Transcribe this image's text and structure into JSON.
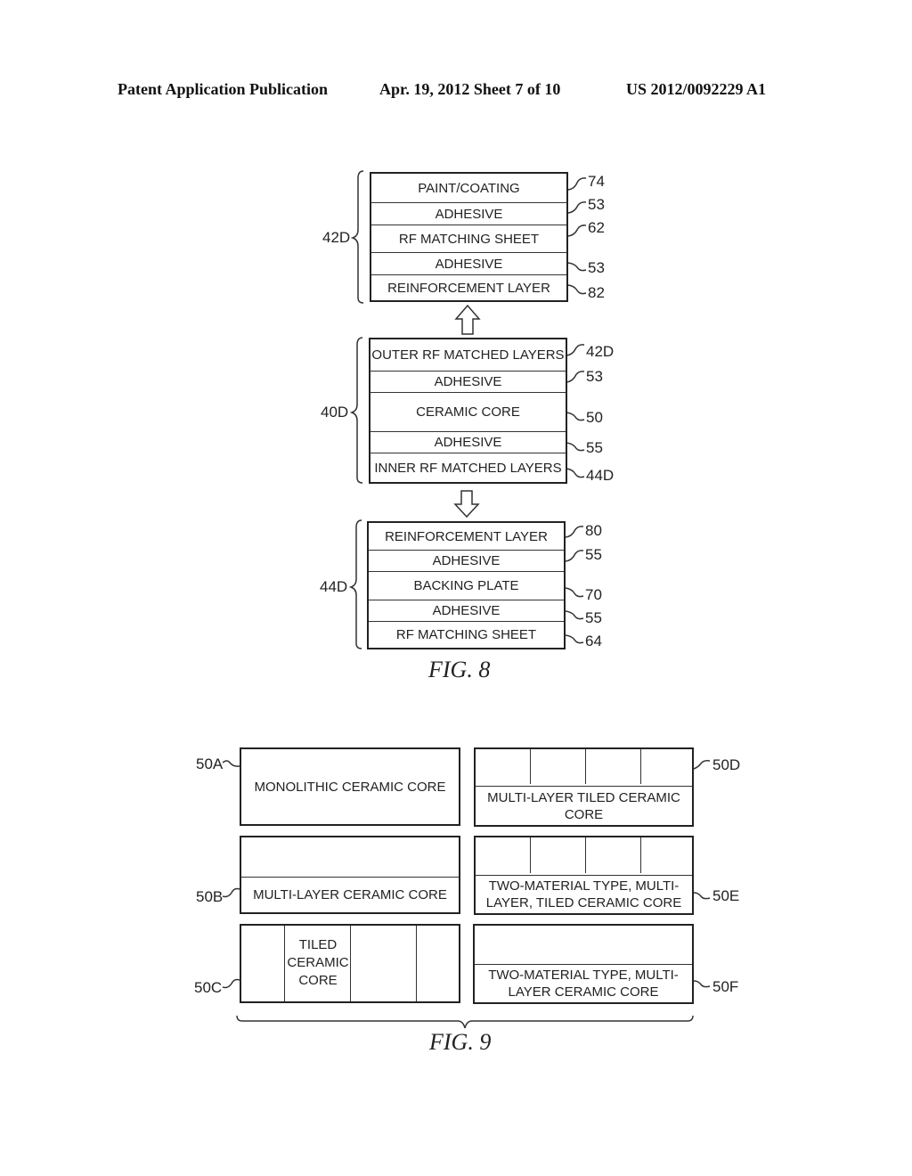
{
  "header": {
    "publication": "Patent Application Publication",
    "date_sheet": "Apr. 19, 2012  Sheet 7 of 10",
    "number": "US 2012/0092229 A1"
  },
  "fig8": {
    "caption": "FIG. 8",
    "stack_42d": {
      "label": "42D",
      "layers": [
        {
          "text": "PAINT/COATING",
          "ref": "74"
        },
        {
          "text": "ADHESIVE",
          "ref": "53"
        },
        {
          "text": "RF MATCHING SHEET",
          "ref": "62"
        },
        {
          "text": "ADHESIVE",
          "ref": "53"
        },
        {
          "text": "REINFORCEMENT LAYER",
          "ref": "82"
        }
      ]
    },
    "stack_40d": {
      "label": "40D",
      "layers": [
        {
          "text": "OUTER RF MATCHED LAYERS",
          "ref": "42D"
        },
        {
          "text": "ADHESIVE",
          "ref": "53"
        },
        {
          "text": "CERAMIC CORE",
          "ref": "50"
        },
        {
          "text": "ADHESIVE",
          "ref": "55"
        },
        {
          "text": "INNER RF MATCHED LAYERS",
          "ref": "44D"
        }
      ]
    },
    "stack_44d": {
      "label": "44D",
      "layers": [
        {
          "text": "REINFORCEMENT LAYER",
          "ref": "80"
        },
        {
          "text": "ADHESIVE",
          "ref": "55"
        },
        {
          "text": "BACKING PLATE",
          "ref": "70"
        },
        {
          "text": "ADHESIVE",
          "ref": "55"
        },
        {
          "text": "RF MATCHING SHEET",
          "ref": "64"
        }
      ]
    }
  },
  "fig9": {
    "caption": "FIG. 9",
    "cores": {
      "a": {
        "ref": "50A",
        "text": "MONOLITHIC CERAMIC CORE"
      },
      "b": {
        "ref": "50B",
        "text": "MULTI-LAYER CERAMIC CORE"
      },
      "c": {
        "ref": "50C",
        "text": "TILED CERAMIC CORE",
        "lines": [
          "TILED",
          "CERAMIC",
          "CORE"
        ]
      },
      "d": {
        "ref": "50D",
        "text": "MULTI-LAYER TILED CERAMIC CORE",
        "lines": [
          "MULTI-LAYER TILED CERAMIC",
          "CORE"
        ]
      },
      "e": {
        "ref": "50E",
        "text": "TWO-MATERIAL TYPE, MULTI-LAYER, TILED CERAMIC CORE",
        "lines": [
          "TWO-MATERIAL TYPE, MULTI-",
          "LAYER, TILED CERAMIC CORE"
        ]
      },
      "f": {
        "ref": "50F",
        "text": "TWO-MATERIAL TYPE, MULTI-LAYER CERAMIC CORE",
        "lines": [
          "TWO-MATERIAL TYPE, MULTI-",
          "LAYER CERAMIC CORE"
        ]
      }
    }
  }
}
